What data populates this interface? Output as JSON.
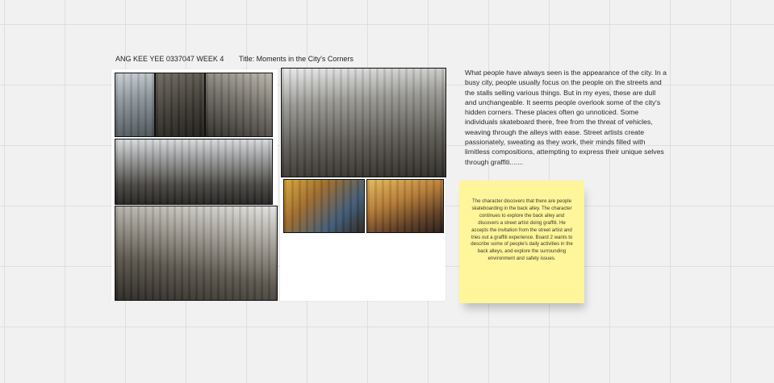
{
  "board": {
    "author_label": "ANG KEE YEE 0337047 WEEK 4",
    "title_label": "Title: Moments in the City's Corners"
  },
  "storyboard_page_1": {
    "panels": [
      "city-skyline",
      "street-market",
      "roadside-stall",
      "skateboarder-jump",
      "alley-skaters"
    ]
  },
  "storyboard_page_2": {
    "panels": [
      "city-alley-wide",
      "graffiti-wall",
      "graffiti-street"
    ]
  },
  "description_text": "What people have always seen is the appearance of the city. In a busy city, people usually focus on the people on the streets and the stalls selling various things. But in my eyes, these are dull and unchangeable. It seems people overlook some of the city's hidden corners. These places often go unnoticed. Some individuals skateboard there, free from the threat of vehicles, weaving through the alleys with ease. Street artists create passionately, sweating as they work, their minds filled with limitless compositions, attempting to express their unique selves through graffiti.......",
  "sticky_note": {
    "text": "The character discovers that there are people skateboarding in the back alley. The character continues to explore the back alley and discovers a street artist doing graffiti. He accepts the invitation from the street artist and tries out a graffiti experience. Board 2 wants to describe some of people's daily activities in the back alleys, and explore the surrounding environment and safety issues.",
    "color": "#fff59a"
  },
  "colors": {
    "canvas": "#f1f1f1",
    "grid_line": "#dedede"
  }
}
